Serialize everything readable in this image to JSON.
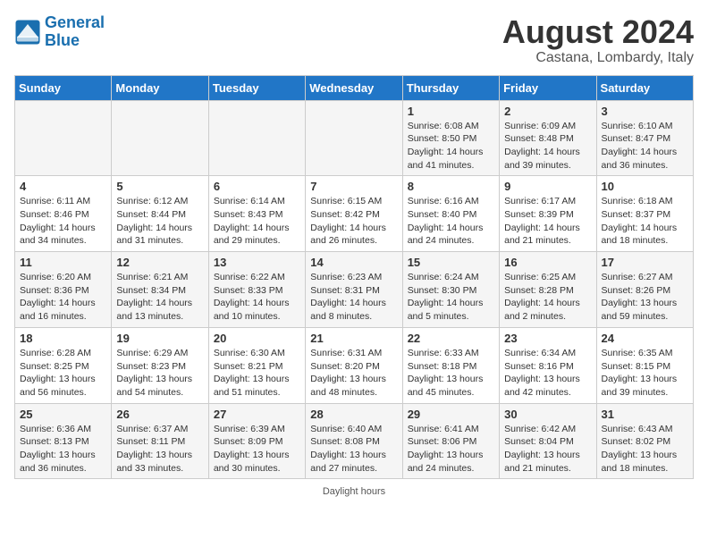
{
  "header": {
    "logo_line1": "General",
    "logo_line2": "Blue",
    "title": "August 2024",
    "subtitle": "Castana, Lombardy, Italy"
  },
  "days_of_week": [
    "Sunday",
    "Monday",
    "Tuesday",
    "Wednesday",
    "Thursday",
    "Friday",
    "Saturday"
  ],
  "weeks": [
    [
      {
        "day": "",
        "info": ""
      },
      {
        "day": "",
        "info": ""
      },
      {
        "day": "",
        "info": ""
      },
      {
        "day": "",
        "info": ""
      },
      {
        "day": "1",
        "info": "Sunrise: 6:08 AM\nSunset: 8:50 PM\nDaylight: 14 hours\nand 41 minutes."
      },
      {
        "day": "2",
        "info": "Sunrise: 6:09 AM\nSunset: 8:48 PM\nDaylight: 14 hours\nand 39 minutes."
      },
      {
        "day": "3",
        "info": "Sunrise: 6:10 AM\nSunset: 8:47 PM\nDaylight: 14 hours\nand 36 minutes."
      }
    ],
    [
      {
        "day": "4",
        "info": "Sunrise: 6:11 AM\nSunset: 8:46 PM\nDaylight: 14 hours\nand 34 minutes."
      },
      {
        "day": "5",
        "info": "Sunrise: 6:12 AM\nSunset: 8:44 PM\nDaylight: 14 hours\nand 31 minutes."
      },
      {
        "day": "6",
        "info": "Sunrise: 6:14 AM\nSunset: 8:43 PM\nDaylight: 14 hours\nand 29 minutes."
      },
      {
        "day": "7",
        "info": "Sunrise: 6:15 AM\nSunset: 8:42 PM\nDaylight: 14 hours\nand 26 minutes."
      },
      {
        "day": "8",
        "info": "Sunrise: 6:16 AM\nSunset: 8:40 PM\nDaylight: 14 hours\nand 24 minutes."
      },
      {
        "day": "9",
        "info": "Sunrise: 6:17 AM\nSunset: 8:39 PM\nDaylight: 14 hours\nand 21 minutes."
      },
      {
        "day": "10",
        "info": "Sunrise: 6:18 AM\nSunset: 8:37 PM\nDaylight: 14 hours\nand 18 minutes."
      }
    ],
    [
      {
        "day": "11",
        "info": "Sunrise: 6:20 AM\nSunset: 8:36 PM\nDaylight: 14 hours\nand 16 minutes."
      },
      {
        "day": "12",
        "info": "Sunrise: 6:21 AM\nSunset: 8:34 PM\nDaylight: 14 hours\nand 13 minutes."
      },
      {
        "day": "13",
        "info": "Sunrise: 6:22 AM\nSunset: 8:33 PM\nDaylight: 14 hours\nand 10 minutes."
      },
      {
        "day": "14",
        "info": "Sunrise: 6:23 AM\nSunset: 8:31 PM\nDaylight: 14 hours\nand 8 minutes."
      },
      {
        "day": "15",
        "info": "Sunrise: 6:24 AM\nSunset: 8:30 PM\nDaylight: 14 hours\nand 5 minutes."
      },
      {
        "day": "16",
        "info": "Sunrise: 6:25 AM\nSunset: 8:28 PM\nDaylight: 14 hours\nand 2 minutes."
      },
      {
        "day": "17",
        "info": "Sunrise: 6:27 AM\nSunset: 8:26 PM\nDaylight: 13 hours\nand 59 minutes."
      }
    ],
    [
      {
        "day": "18",
        "info": "Sunrise: 6:28 AM\nSunset: 8:25 PM\nDaylight: 13 hours\nand 56 minutes."
      },
      {
        "day": "19",
        "info": "Sunrise: 6:29 AM\nSunset: 8:23 PM\nDaylight: 13 hours\nand 54 minutes."
      },
      {
        "day": "20",
        "info": "Sunrise: 6:30 AM\nSunset: 8:21 PM\nDaylight: 13 hours\nand 51 minutes."
      },
      {
        "day": "21",
        "info": "Sunrise: 6:31 AM\nSunset: 8:20 PM\nDaylight: 13 hours\nand 48 minutes."
      },
      {
        "day": "22",
        "info": "Sunrise: 6:33 AM\nSunset: 8:18 PM\nDaylight: 13 hours\nand 45 minutes."
      },
      {
        "day": "23",
        "info": "Sunrise: 6:34 AM\nSunset: 8:16 PM\nDaylight: 13 hours\nand 42 minutes."
      },
      {
        "day": "24",
        "info": "Sunrise: 6:35 AM\nSunset: 8:15 PM\nDaylight: 13 hours\nand 39 minutes."
      }
    ],
    [
      {
        "day": "25",
        "info": "Sunrise: 6:36 AM\nSunset: 8:13 PM\nDaylight: 13 hours\nand 36 minutes."
      },
      {
        "day": "26",
        "info": "Sunrise: 6:37 AM\nSunset: 8:11 PM\nDaylight: 13 hours\nand 33 minutes."
      },
      {
        "day": "27",
        "info": "Sunrise: 6:39 AM\nSunset: 8:09 PM\nDaylight: 13 hours\nand 30 minutes."
      },
      {
        "day": "28",
        "info": "Sunrise: 6:40 AM\nSunset: 8:08 PM\nDaylight: 13 hours\nand 27 minutes."
      },
      {
        "day": "29",
        "info": "Sunrise: 6:41 AM\nSunset: 8:06 PM\nDaylight: 13 hours\nand 24 minutes."
      },
      {
        "day": "30",
        "info": "Sunrise: 6:42 AM\nSunset: 8:04 PM\nDaylight: 13 hours\nand 21 minutes."
      },
      {
        "day": "31",
        "info": "Sunrise: 6:43 AM\nSunset: 8:02 PM\nDaylight: 13 hours\nand 18 minutes."
      }
    ]
  ],
  "footer": "Daylight hours"
}
